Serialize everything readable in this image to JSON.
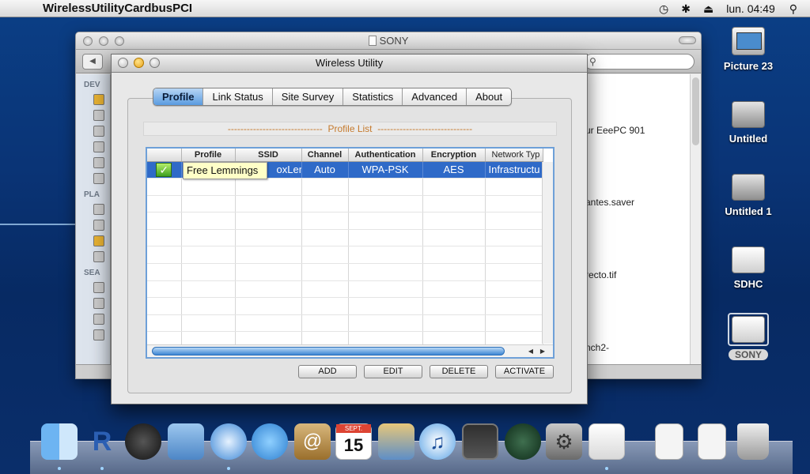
{
  "menubar": {
    "apple_glyph": "",
    "app_name": "WirelessUtilityCardbusPCI",
    "time_machine_glyph": "◷",
    "bluetooth_glyph": "✱",
    "eject_glyph": "⏏",
    "clock": "lun. 04:49",
    "spotlight_glyph": "⚲"
  },
  "finder": {
    "title": "SONY",
    "back_glyph": "◀",
    "search_glyph": "⚲",
    "sidebar_headers": [
      "DEV",
      "PLA",
      "SEA"
    ],
    "files": [
      "ur EeePC 901",
      "antes.saver",
      "recto.tif",
      "nch2-"
    ]
  },
  "wireless": {
    "title": "Wireless Utility",
    "tabs": [
      "Profile",
      "Link Status",
      "Site Survey",
      "Statistics",
      "Advanced",
      "About"
    ],
    "active_tab": "Profile",
    "profile_list_label": "Profile List",
    "profile_list_dashes": "------------------------------",
    "columns": [
      "",
      "Profile",
      "SSID",
      "Channel",
      "Authentication",
      "Encryption",
      "Network Typ"
    ],
    "rows": [
      {
        "check": "✓",
        "profile": "",
        "ssid": "oxLemi",
        "channel": "Auto",
        "authentication": "WPA-PSK",
        "encryption": "AES",
        "network_type": "Infrastructu"
      }
    ],
    "tooltip": "Free Lemmings",
    "scroll_left": "◀",
    "scroll_right": "▶",
    "buttons": {
      "add": "ADD",
      "edit": "EDIT",
      "delete": "DELETE",
      "activate": "ACTIVATE"
    }
  },
  "desktop": {
    "icons": [
      "Picture 23",
      "Untitled",
      "Untitled 1",
      "SDHC",
      "SONY"
    ]
  },
  "dock": {
    "items": [
      "Finder",
      "R",
      "Dashboard",
      "Preview",
      "Safari",
      "iChat",
      "Address Book",
      "iCal",
      "iPhoto",
      "iTunes",
      "Spaces",
      "Time Machine",
      "System Preferences",
      "TextEdit",
      "PDF",
      "PDF",
      "Trash"
    ],
    "ical_day": "15",
    "ical_month": "SEPT."
  },
  "colors": {
    "desktop": "#0a3476",
    "selection": "#2f6ac8",
    "tab_active": "#5a9be0",
    "profile_list_label": "#c57a2d"
  }
}
